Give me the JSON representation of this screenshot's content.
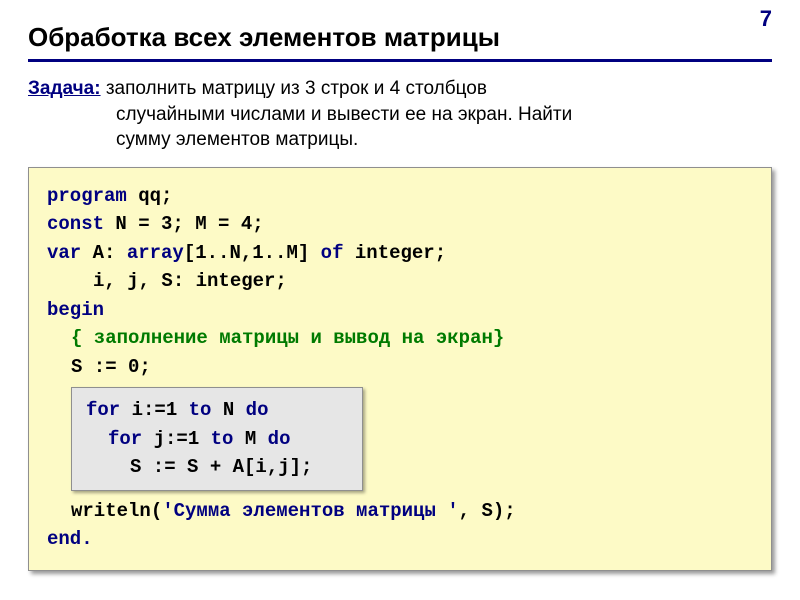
{
  "pageNumber": "7",
  "title": "Обработка всех элементов матрицы",
  "task": {
    "label": "Задача:",
    "line1": " заполнить матрицу из 3 строк и 4 столбцов",
    "line2": "случайными числами и вывести ее на экран. Найти",
    "line3": "сумму элементов матрицы."
  },
  "code": {
    "l1a": "program",
    "l1b": " qq;",
    "l2a": "const",
    "l2b": " N = 3; M = 4;",
    "l3a": "var",
    "l3b": " A: ",
    "l3c": "array",
    "l3d": "[1..N,1..M] ",
    "l3e": "of",
    "l3f": " integer;",
    "l4": "i, j, S: integer;",
    "l5": "begin",
    "l6": "{ заполнение матрицы и вывод на экран}",
    "l7": "S := 0;",
    "inner": {
      "l1a": "for",
      "l1b": " i:=1 ",
      "l1c": "to",
      "l1d": " N ",
      "l1e": "do",
      "l2a": "for",
      "l2b": " j:=1 ",
      "l2c": "to",
      "l2d": " M ",
      "l2e": "do",
      "l3": "S := S + A[i,j];"
    },
    "l8a": "writeln(",
    "l8b": "'Сумма элементов матрицы '",
    "l8c": ", S);",
    "l9": "end."
  }
}
